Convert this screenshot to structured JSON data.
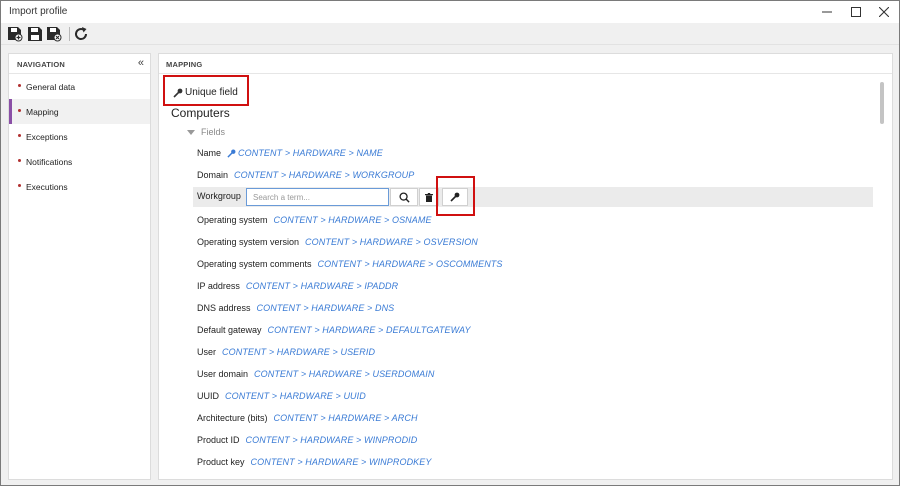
{
  "window": {
    "title": "Import profile"
  },
  "navigation": {
    "header": "NAVIGATION",
    "items": [
      {
        "label": "General data"
      },
      {
        "label": "Mapping"
      },
      {
        "label": "Exceptions"
      },
      {
        "label": "Notifications"
      },
      {
        "label": "Executions"
      }
    ]
  },
  "mapping": {
    "header": "MAPPING",
    "unique_label": "Unique field",
    "section_title": "Computers",
    "fields_label": "Fields",
    "name_label": "Name",
    "name_path": "CONTENT > HARDWARE > NAME",
    "domain_label": "Domain",
    "domain_path": "CONTENT > HARDWARE > WORKGROUP",
    "workgroup_label": "Workgroup",
    "search_placeholder": "Search a term...",
    "rows": [
      {
        "label": "Operating system",
        "path": "CONTENT > HARDWARE > OSNAME"
      },
      {
        "label": "Operating system version",
        "path": "CONTENT > HARDWARE > OSVERSION"
      },
      {
        "label": "Operating system comments",
        "path": "CONTENT > HARDWARE > OSCOMMENTS"
      },
      {
        "label": "IP address",
        "path": "CONTENT > HARDWARE > IPADDR"
      },
      {
        "label": "DNS address",
        "path": "CONTENT > HARDWARE > DNS"
      },
      {
        "label": "Default gateway",
        "path": "CONTENT > HARDWARE > DEFAULTGATEWAY"
      },
      {
        "label": "User",
        "path": "CONTENT > HARDWARE > USERID"
      },
      {
        "label": "User domain",
        "path": "CONTENT > HARDWARE > USERDOMAIN"
      },
      {
        "label": "UUID",
        "path": "CONTENT > HARDWARE > UUID"
      },
      {
        "label": "Architecture (bits)",
        "path": "CONTENT > HARDWARE > ARCH"
      },
      {
        "label": "Product ID",
        "path": "CONTENT > HARDWARE > WINPRODID"
      },
      {
        "label": "Product key",
        "path": "CONTENT > HARDWARE > WINPRODKEY"
      }
    ]
  },
  "icons": {
    "toolbar": [
      "save-new-icon",
      "save-icon",
      "save-close-icon",
      "refresh-icon"
    ],
    "window_controls": [
      "minimize-icon",
      "maximize-icon",
      "close-icon"
    ]
  },
  "colors": {
    "accent": "#8a4fa6",
    "link": "#3a7bd5",
    "highlight": "#d01010"
  }
}
